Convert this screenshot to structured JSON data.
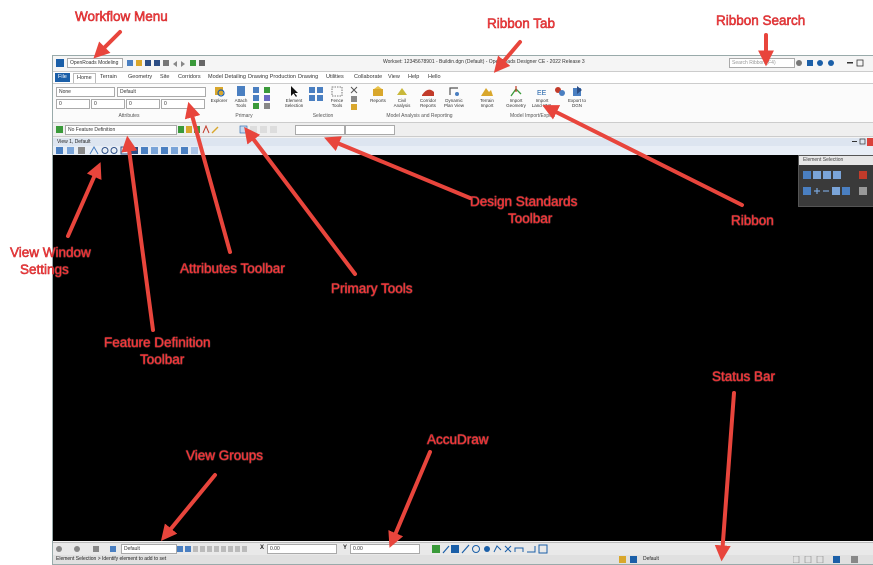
{
  "window": {
    "workflow_label": "OpenRoads Modeling",
    "title": "Workset: 12345678901 - Buildin.dgn (Default) - OpenRoads Designer CE - 2022 Release 3",
    "search_placeholder": "Search Ribbon (F4)"
  },
  "tabs": [
    "File",
    "Home",
    "Terrain",
    "Geometry",
    "Site",
    "Corridors",
    "Model Detailing",
    "Drawing Production",
    "Drawing",
    "Utilities",
    "Collaborate",
    "View",
    "Help",
    "Hello"
  ],
  "attributes": {
    "level": "None",
    "style": "Default",
    "color_value": "0",
    "weight_value": "0",
    "transp_value": "0",
    "group_label": "Attributes"
  },
  "primary": {
    "explorer": "Explorer",
    "attach_tools": "Attach Tools",
    "group_label": "Primary"
  },
  "selection": {
    "element_selection": "Element Selection",
    "fence_tools": "Fence Tools",
    "group_label": "Selection"
  },
  "analysis": {
    "reports": "Reports",
    "civil_analysis": "Civil Analysis",
    "corridor_reports": "Corridor Reports",
    "dynamic_plan_view": "Dynamic Plan View",
    "group_label": "Model Analysis and Reporting"
  },
  "import_export": {
    "terrain_import": "Terrain Import",
    "import_geometry": "Import Geometry",
    "import_land": "Import Land XML",
    "export_to_dgn": "Export to DGN",
    "group_label": "Model Import/Export"
  },
  "feature_definition": "No Feature Definition",
  "view": {
    "title": "View 1, Default"
  },
  "element_selection_panel": "Element Selection",
  "bottom": {
    "view_group": "Default",
    "x_label": "X",
    "x_value": "0.00",
    "y_label": "Y",
    "y_value": "0.00"
  },
  "status": {
    "left_text": "Element Selection > Identify element to add to set",
    "level": "Default"
  },
  "callouts": {
    "workflow_menu": "Workflow Menu",
    "ribbon_tab": "Ribbon Tab",
    "ribbon_search": "Ribbon Search",
    "design_standards_1": "Design Standards",
    "design_standards_2": "Toolbar",
    "ribbon": "Ribbon",
    "view_window_1": "View Window",
    "view_window_2": "Settings",
    "attributes_toolbar": "Attributes Toolbar",
    "primary_tools": "Primary Tools",
    "feature_def_1": "Feature Definition",
    "feature_def_2": "Toolbar",
    "status_bar": "Status Bar",
    "view_groups": "View Groups",
    "accudraw": "AccuDraw"
  },
  "colors": {
    "callout": "#ff4c4c",
    "arrow": "#e8453c",
    "view_background": "#000000",
    "file_tab": "#1b5fa8"
  }
}
